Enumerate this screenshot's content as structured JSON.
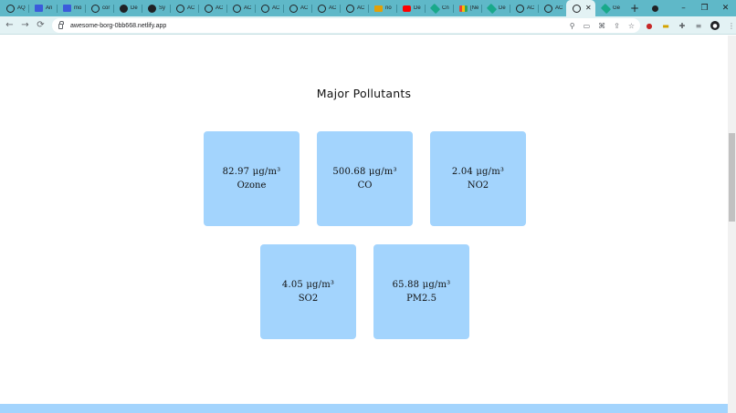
{
  "browser": {
    "tabs": [
      {
        "title": "AQ",
        "icon": "globe-icon"
      },
      {
        "title": "An",
        "icon": "translate-icon"
      },
      {
        "title": "mo",
        "icon": "translate-icon"
      },
      {
        "title": "cor",
        "icon": "globe-icon"
      },
      {
        "title": "De",
        "icon": "dev-icon"
      },
      {
        "title": "Sy",
        "icon": "github-icon"
      },
      {
        "title": "AC",
        "icon": "globe-icon"
      },
      {
        "title": "AC",
        "icon": "globe-icon"
      },
      {
        "title": "AC",
        "icon": "globe-icon"
      },
      {
        "title": "AC",
        "icon": "globe-icon"
      },
      {
        "title": "AC",
        "icon": "globe-icon"
      },
      {
        "title": "AC",
        "icon": "globe-icon"
      },
      {
        "title": "AC",
        "icon": "globe-icon"
      },
      {
        "title": "no",
        "icon": "folder-icon"
      },
      {
        "title": "De",
        "icon": "youtube-icon"
      },
      {
        "title": "Cn",
        "icon": "diamond-icon"
      },
      {
        "title": "[Ne",
        "icon": "gmail-icon"
      },
      {
        "title": "De",
        "icon": "diamond-icon"
      },
      {
        "title": "AC",
        "icon": "globe-icon"
      },
      {
        "title": "AC",
        "icon": "globe-icon"
      },
      {
        "title": "",
        "icon": "globe-icon",
        "active": true
      },
      {
        "title": "Ge",
        "icon": "diamond-icon"
      }
    ],
    "new_tab_symbol": "+",
    "window_controls": {
      "minimize": "–",
      "restore": "❐",
      "close": "✕"
    },
    "url": "awesome-borg-0bb668.netlify.app"
  },
  "page": {
    "section_title": "Major Pollutants",
    "pollutants": [
      {
        "value": "82.97 μg/m³",
        "name": "Ozone"
      },
      {
        "value": "500.68 μg/m³",
        "name": "CO"
      },
      {
        "value": "2.04 μg/m³",
        "name": "NO2"
      },
      {
        "value": "4.05 μg/m³",
        "name": "SO2"
      },
      {
        "value": "65.88 μg/m³",
        "name": "PM2.5"
      }
    ]
  },
  "colors": {
    "tabstrip": "#5fb8c8",
    "toolbar": "#e3f2f4",
    "card": "#a3d4fd",
    "footer": "#a3d4fd"
  }
}
